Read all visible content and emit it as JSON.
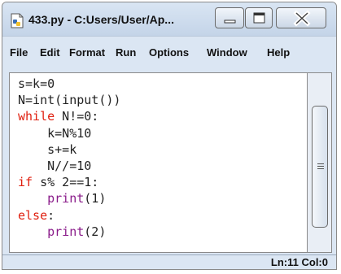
{
  "window": {
    "title": "433.py - C:Users/User/Ap...",
    "controls": {
      "minimize": "minimize-icon",
      "maximize": "maximize-icon",
      "close": "close-icon"
    }
  },
  "menu": {
    "items": [
      {
        "label": "File"
      },
      {
        "label": "Edit"
      },
      {
        "label": "Format"
      },
      {
        "label": "Run"
      },
      {
        "label": "Options"
      },
      {
        "label": "Window"
      },
      {
        "label": "Help"
      }
    ]
  },
  "editor": {
    "lines": [
      {
        "indent": "",
        "kw": "",
        "text": "s=k=0"
      },
      {
        "indent": "",
        "kw": "",
        "text": "N=int(input())"
      },
      {
        "indent": "",
        "kw": "while",
        "text": " N!=0:"
      },
      {
        "indent": "    ",
        "kw": "",
        "text": "k=N%10"
      },
      {
        "indent": "    ",
        "kw": "",
        "text": "s+=k"
      },
      {
        "indent": "    ",
        "kw": "",
        "text": "N//=10"
      },
      {
        "indent": "",
        "kw": "if",
        "text": " s% 2==1:"
      },
      {
        "indent": "    ",
        "bi": "print",
        "text": "(1)"
      },
      {
        "indent": "",
        "kw": "else",
        "text": ":"
      },
      {
        "indent": "    ",
        "bi": "print",
        "text": "(2)"
      }
    ],
    "colors": {
      "keyword": "#e02010",
      "builtin": "#8a1c8a",
      "text": "#222222"
    }
  },
  "status": {
    "position": "Ln:11 Col:0"
  }
}
